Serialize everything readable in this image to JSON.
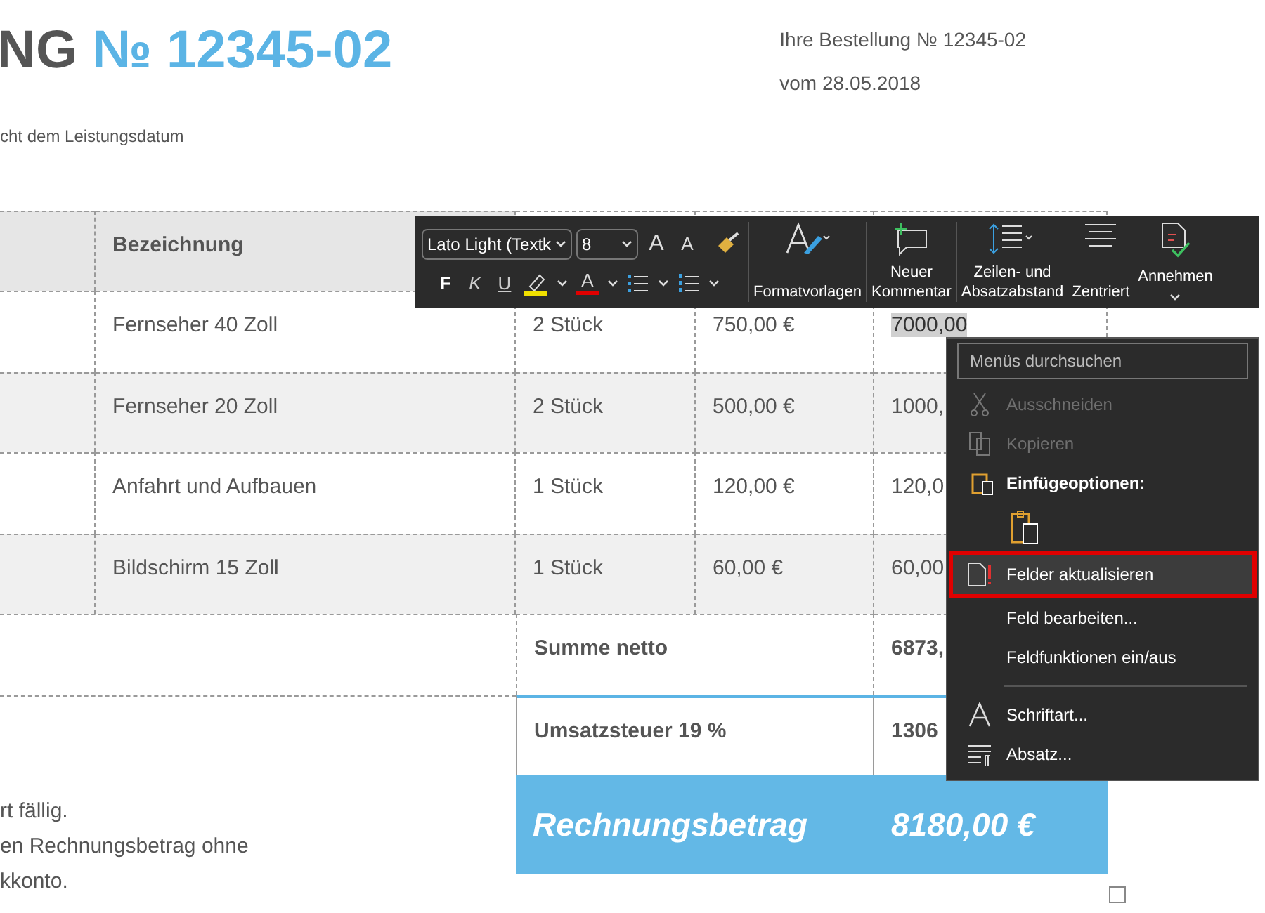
{
  "heading": {
    "prefix": "NG",
    "number": "№ 12345-02"
  },
  "subtitle": "cht dem Leistungsdatum",
  "order": {
    "line_1": "Ihre Bestellung № 12345-02",
    "line_2": "vom 28.05.2018"
  },
  "table": {
    "columns": [
      "Bezeichnung"
    ],
    "rows": [
      {
        "description": "Fernseher 40 Zoll",
        "quantity": "2 Stück",
        "price": "750,00 €",
        "total": "7000,00",
        "shaded": false,
        "total_selected": true
      },
      {
        "description": "Fernseher 20 Zoll",
        "quantity": "2 Stück",
        "price": "500,00 €",
        "total": "1000,",
        "shaded": true,
        "total_selected": false
      },
      {
        "description": "Anfahrt und Aufbauen",
        "quantity": "1 Stück",
        "price": "120,00 €",
        "total": "120,0",
        "shaded": false,
        "total_selected": false
      },
      {
        "description": "Bildschirm 15 Zoll",
        "quantity": "1 Stück",
        "price": "60,00 €",
        "total": "60,00",
        "shaded": true,
        "total_selected": false
      }
    ],
    "summary": [
      {
        "label": "Summe netto",
        "value": "6873,"
      },
      {
        "label": "Umsatzsteuer 19 %",
        "value": "1306"
      }
    ],
    "grand_total": {
      "label": "Rechnungsbetrag",
      "value": "8180,00 €"
    }
  },
  "footer_text": [
    "rt fällig.",
    "en Rechnungsbetrag ohne",
    "kkonto."
  ],
  "toolbar": {
    "font": "Lato Light (Textk",
    "size": "8",
    "grow_font": "A",
    "shrink_font": "A",
    "format_letters": [
      "F",
      "K",
      "U"
    ],
    "font_color": "A",
    "buttons": [
      {
        "label": "Formatvorlagen"
      },
      {
        "label": "Neuer\nKommentar"
      },
      {
        "label": "Zeilen- und\nAbsatzabstand"
      },
      {
        "label": "Zentriert"
      },
      {
        "label": "Annehmen"
      }
    ]
  },
  "context_menu": {
    "search": {
      "placeholder": "Menüs durchsuchen"
    },
    "items": [
      {
        "kind": "item",
        "label": "Ausschneiden",
        "disabled": true,
        "selected": false
      },
      {
        "kind": "item",
        "label": "Kopieren",
        "disabled": true,
        "selected": false
      },
      {
        "kind": "heading",
        "label": "Einfügeoptionen:"
      },
      {
        "kind": "paste-option"
      },
      {
        "kind": "item",
        "label": "Felder aktualisieren",
        "disabled": false,
        "selected": true
      },
      {
        "kind": "item",
        "label": "Feld bearbeiten...",
        "disabled": false,
        "selected": false
      },
      {
        "kind": "item",
        "label": "Feldfunktionen ein/aus",
        "disabled": false,
        "selected": false
      },
      {
        "kind": "separator"
      },
      {
        "kind": "item",
        "label": "Schriftart...",
        "disabled": false,
        "selected": false
      },
      {
        "kind": "item",
        "label": "Absatz...",
        "disabled": false,
        "selected": false
      }
    ]
  }
}
